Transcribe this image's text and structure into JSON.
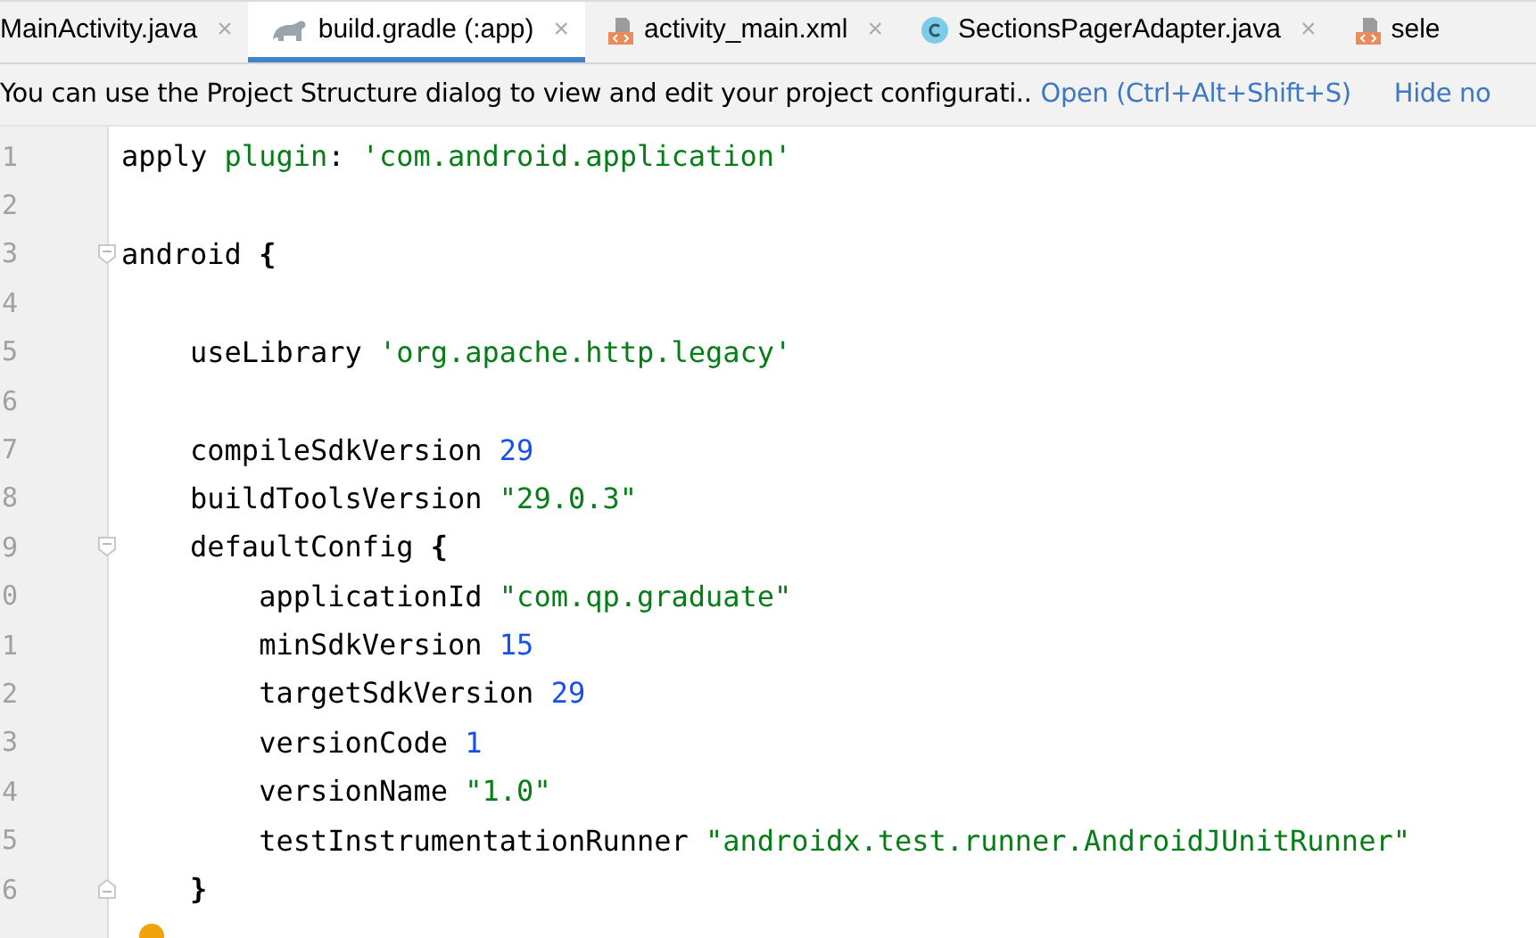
{
  "tabs": [
    {
      "label": "MainActivity.java",
      "kind": "plain",
      "selected": false,
      "closable": true
    },
    {
      "label": "build.gradle (:app)",
      "kind": "gradle",
      "selected": true,
      "closable": true
    },
    {
      "label": "activity_main.xml",
      "kind": "xml",
      "selected": false,
      "closable": true
    },
    {
      "label": "SectionsPagerAdapter.java",
      "kind": "class",
      "selected": false,
      "closable": true
    },
    {
      "label": "sele",
      "kind": "xml",
      "selected": false,
      "closable": false
    }
  ],
  "tab_close": "×",
  "notification": {
    "message": "You can use the Project Structure dialog to view and edit your project configurati..",
    "links": [
      "Open (Ctrl+Alt+Shift+S)",
      "Hide no"
    ]
  },
  "lines": [
    {
      "number": "1",
      "kind": "plain",
      "tokens": [
        {
          "kind": "plain",
          "text": "apply "
        },
        {
          "kind": "keyword",
          "text": "plugin"
        },
        {
          "kind": "plain",
          "text": ": "
        },
        {
          "kind": "string",
          "text": "'com.android.application'"
        }
      ]
    },
    {
      "number": "2",
      "kind": "plain"
    },
    {
      "number": "3",
      "kind": "foldstart",
      "tokens": [
        {
          "kind": "plain",
          "text": "android "
        },
        {
          "kind": "brace",
          "text": "{"
        }
      ]
    },
    {
      "number": "4",
      "kind": "plain"
    },
    {
      "number": "5",
      "kind": "plain",
      "tokens": [
        {
          "kind": "plain",
          "text": "    useLibrary "
        },
        {
          "kind": "string",
          "text": "'org.apache.http.legacy'"
        }
      ]
    },
    {
      "number": "6",
      "kind": "plain"
    },
    {
      "number": "7",
      "kind": "plain",
      "tokens": [
        {
          "kind": "plain",
          "text": "    compileSdkVersion "
        },
        {
          "kind": "number",
          "text": "29"
        }
      ]
    },
    {
      "number": "8",
      "kind": "plain",
      "tokens": [
        {
          "kind": "plain",
          "text": "    buildToolsVersion "
        },
        {
          "kind": "string",
          "text": "\"29.0.3\""
        }
      ]
    },
    {
      "number": "9",
      "kind": "foldstart",
      "tokens": [
        {
          "kind": "plain",
          "text": "    defaultConfig "
        },
        {
          "kind": "brace",
          "text": "{"
        }
      ]
    },
    {
      "number": "0",
      "kind": "plain",
      "tokens": [
        {
          "kind": "plain",
          "text": "        applicationId "
        },
        {
          "kind": "string",
          "text": "\"com.qp.graduate\""
        }
      ]
    },
    {
      "number": "1",
      "kind": "plain",
      "tokens": [
        {
          "kind": "plain",
          "text": "        minSdkVersion "
        },
        {
          "kind": "number",
          "text": "15"
        }
      ]
    },
    {
      "number": "2",
      "kind": "plain",
      "tokens": [
        {
          "kind": "plain",
          "text": "        targetSdkVersion "
        },
        {
          "kind": "number",
          "text": "29"
        }
      ]
    },
    {
      "number": "3",
      "kind": "plain",
      "tokens": [
        {
          "kind": "plain",
          "text": "        versionCode "
        },
        {
          "kind": "number",
          "text": "1"
        }
      ]
    },
    {
      "number": "4",
      "kind": "plain",
      "tokens": [
        {
          "kind": "plain",
          "text": "        versionName "
        },
        {
          "kind": "string",
          "text": "\"1.0\""
        }
      ]
    },
    {
      "number": "5",
      "kind": "plain",
      "tokens": [
        {
          "kind": "plain",
          "text": "        testInstrumentationRunner "
        },
        {
          "kind": "string",
          "text": "\"androidx.test.runner.AndroidJUnitRunner\""
        }
      ]
    },
    {
      "number": "6",
      "kind": "foldend",
      "tokens": [
        {
          "kind": "brace",
          "text": "    }"
        }
      ]
    }
  ],
  "intention_bulb": true
}
